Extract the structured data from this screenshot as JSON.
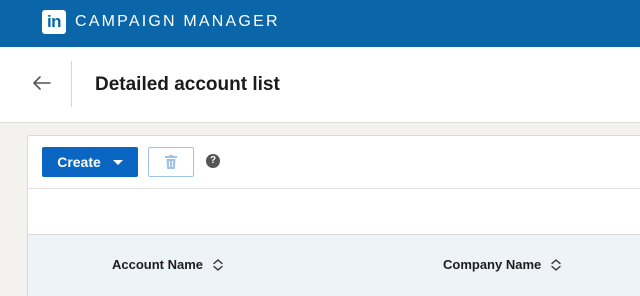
{
  "topbar": {
    "logo_text": "in",
    "brand": "CAMPAIGN MANAGER",
    "background": "#0a66a8"
  },
  "header": {
    "back_icon": "arrow-left-icon",
    "title": "Detailed account list"
  },
  "toolbar": {
    "create_label": "Create",
    "create_icon": "caret-down-icon",
    "delete_icon": "trash-icon",
    "help_text": "?",
    "accent": "#0a66c2"
  },
  "table": {
    "columns": [
      {
        "label": "Account Name",
        "sort_icon": "sort-icon"
      },
      {
        "label": "Company Name",
        "sort_icon": "sort-icon"
      }
    ]
  }
}
